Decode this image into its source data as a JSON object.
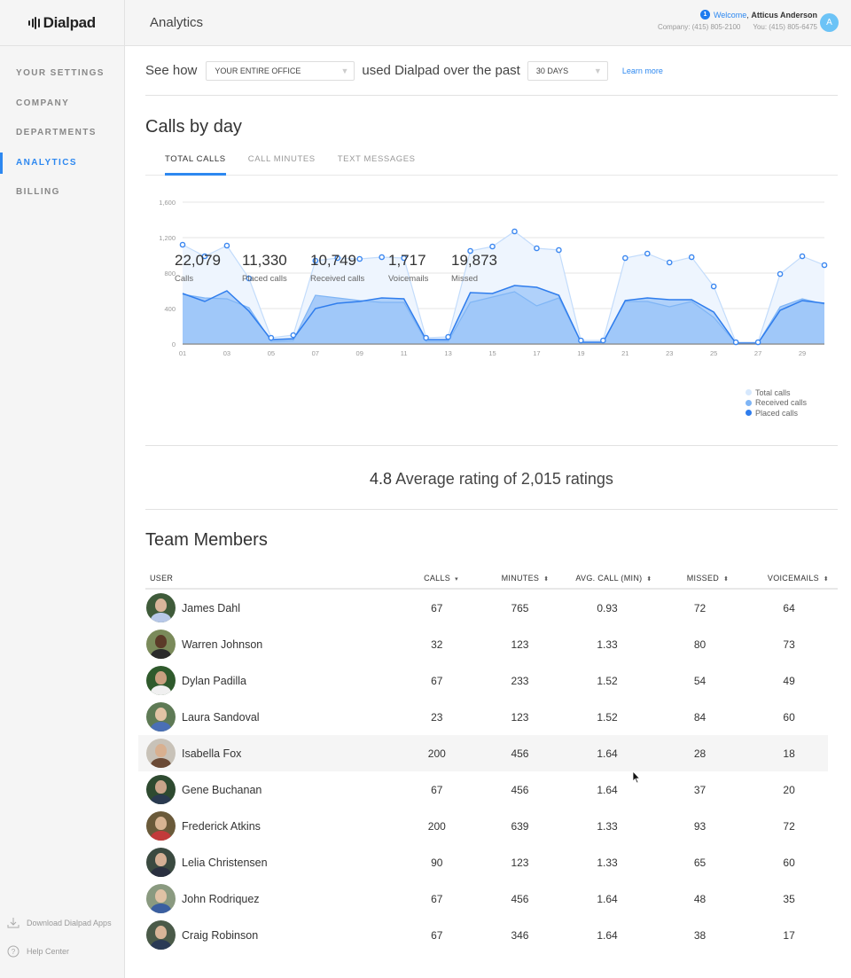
{
  "app": {
    "brand": "Dialpad",
    "page_title": "Analytics"
  },
  "sidebar": {
    "items": [
      {
        "label": "YOUR SETTINGS",
        "active": false
      },
      {
        "label": "COMPANY",
        "active": false
      },
      {
        "label": "DEPARTMENTS",
        "active": false
      },
      {
        "label": "ANALYTICS",
        "active": true
      },
      {
        "label": "BILLING",
        "active": false
      }
    ],
    "footer": {
      "download": "Download Dialpad Apps",
      "help": "Help Center"
    }
  },
  "header": {
    "notification_count": "1",
    "welcome": "Welcome",
    "user_name": "Atticus Anderson",
    "company_phone": "Company: (415) 805-2100",
    "your_phone": "You: (415) 805-6475",
    "avatar_initial": "A"
  },
  "filter": {
    "prefix": "See how",
    "scope_value": "YOUR ENTIRE OFFICE",
    "middle": "used Dialpad over the past",
    "period_value": "30 DAYS",
    "learn_more": "Learn more"
  },
  "calls_by_day": {
    "title": "Calls by day",
    "tabs": [
      {
        "label": "TOTAL CALLS",
        "active": true
      },
      {
        "label": "CALL MINUTES",
        "active": false
      },
      {
        "label": "TEXT MESSAGES",
        "active": false
      }
    ],
    "stats": [
      {
        "value": "22,079",
        "label": "Calls"
      },
      {
        "value": "11,330",
        "label": "Placed calls"
      },
      {
        "value": "10,749",
        "label": "Received calls"
      },
      {
        "value": "1,717",
        "label": "Voicemails"
      },
      {
        "value": "19,873",
        "label": "Missed"
      }
    ]
  },
  "chart_data": {
    "type": "area",
    "title": "Calls by day",
    "xlabel": "",
    "ylabel": "",
    "x": [
      "01",
      "02",
      "03",
      "04",
      "05",
      "06",
      "07",
      "08",
      "09",
      "10",
      "11",
      "12",
      "13",
      "14",
      "15",
      "16",
      "17",
      "18",
      "19",
      "20",
      "21",
      "22",
      "23",
      "24",
      "25",
      "26",
      "27",
      "28",
      "29",
      "30"
    ],
    "x_tick_labels": [
      "01",
      "03",
      "05",
      "07",
      "09",
      "11",
      "13",
      "15",
      "17",
      "19",
      "21",
      "23",
      "25",
      "27",
      "29"
    ],
    "y_ticks": [
      0,
      400,
      800,
      1200,
      1600
    ],
    "y_tick_labels": [
      "0",
      "400",
      "800",
      "1,200",
      "1,600"
    ],
    "ylim": [
      0,
      1600
    ],
    "grid": true,
    "legend_position": "bottom-right",
    "series": [
      {
        "name": "Total calls",
        "color": "#d6e8fd",
        "values": [
          1120,
          990,
          1110,
          740,
          70,
          100,
          940,
          970,
          960,
          980,
          970,
          70,
          80,
          1050,
          1100,
          1270,
          1080,
          1060,
          40,
          40,
          970,
          1020,
          920,
          980,
          650,
          20,
          20,
          790,
          990,
          890
        ]
      },
      {
        "name": "Received calls",
        "color": "#7fb5f5",
        "values": [
          560,
          520,
          510,
          410,
          30,
          40,
          550,
          520,
          490,
          470,
          470,
          30,
          30,
          470,
          530,
          590,
          430,
          520,
          20,
          20,
          480,
          480,
          420,
          480,
          300,
          10,
          10,
          420,
          510,
          450
        ]
      },
      {
        "name": "Placed calls",
        "color": "#2f7ded",
        "values": [
          570,
          480,
          600,
          370,
          50,
          60,
          400,
          460,
          480,
          520,
          510,
          50,
          50,
          580,
          570,
          660,
          640,
          550,
          20,
          20,
          490,
          520,
          500,
          500,
          360,
          10,
          10,
          380,
          490,
          460
        ]
      }
    ]
  },
  "rating": {
    "value": "4.8",
    "text": "Average rating of 2,015 ratings"
  },
  "team": {
    "title": "Team Members",
    "columns": [
      {
        "label": "USER",
        "sort": ""
      },
      {
        "label": "CALLS",
        "sort": "▾"
      },
      {
        "label": "MINUTES",
        "sort": "⬍"
      },
      {
        "label": "AVG. CALL (MIN)",
        "sort": "⬍"
      },
      {
        "label": "MISSED",
        "sort": "⬍"
      },
      {
        "label": "VOICEMAILS",
        "sort": "⬍"
      }
    ],
    "rows": [
      {
        "name": "James Dahl",
        "calls": "67",
        "minutes": "765",
        "avg": "0.93",
        "missed": "72",
        "voicemails": "64"
      },
      {
        "name": "Warren Johnson",
        "calls": "32",
        "minutes": "123",
        "avg": "1.33",
        "missed": "80",
        "voicemails": "73"
      },
      {
        "name": "Dylan Padilla",
        "calls": "67",
        "minutes": "233",
        "avg": "1.52",
        "missed": "54",
        "voicemails": "49"
      },
      {
        "name": "Laura Sandoval",
        "calls": "23",
        "minutes": "123",
        "avg": "1.52",
        "missed": "84",
        "voicemails": "60"
      },
      {
        "name": "Isabella Fox",
        "calls": "200",
        "minutes": "456",
        "avg": "1.64",
        "missed": "28",
        "voicemails": "18"
      },
      {
        "name": "Gene Buchanan",
        "calls": "67",
        "minutes": "456",
        "avg": "1.64",
        "missed": "37",
        "voicemails": "20"
      },
      {
        "name": "Frederick Atkins",
        "calls": "200",
        "minutes": "639",
        "avg": "1.33",
        "missed": "93",
        "voicemails": "72"
      },
      {
        "name": "Lelia Christensen",
        "calls": "90",
        "minutes": "123",
        "avg": "1.33",
        "missed": "65",
        "voicemails": "60"
      },
      {
        "name": "John Rodriquez",
        "calls": "67",
        "minutes": "456",
        "avg": "1.64",
        "missed": "48",
        "voicemails": "35"
      },
      {
        "name": "Craig Robinson",
        "calls": "67",
        "minutes": "346",
        "avg": "1.64",
        "missed": "38",
        "voicemails": "17"
      }
    ]
  },
  "colors": {
    "accent": "#2d88f0",
    "sidebar_bg": "#f5f5f5",
    "row_hover": "#f5f5f5"
  }
}
